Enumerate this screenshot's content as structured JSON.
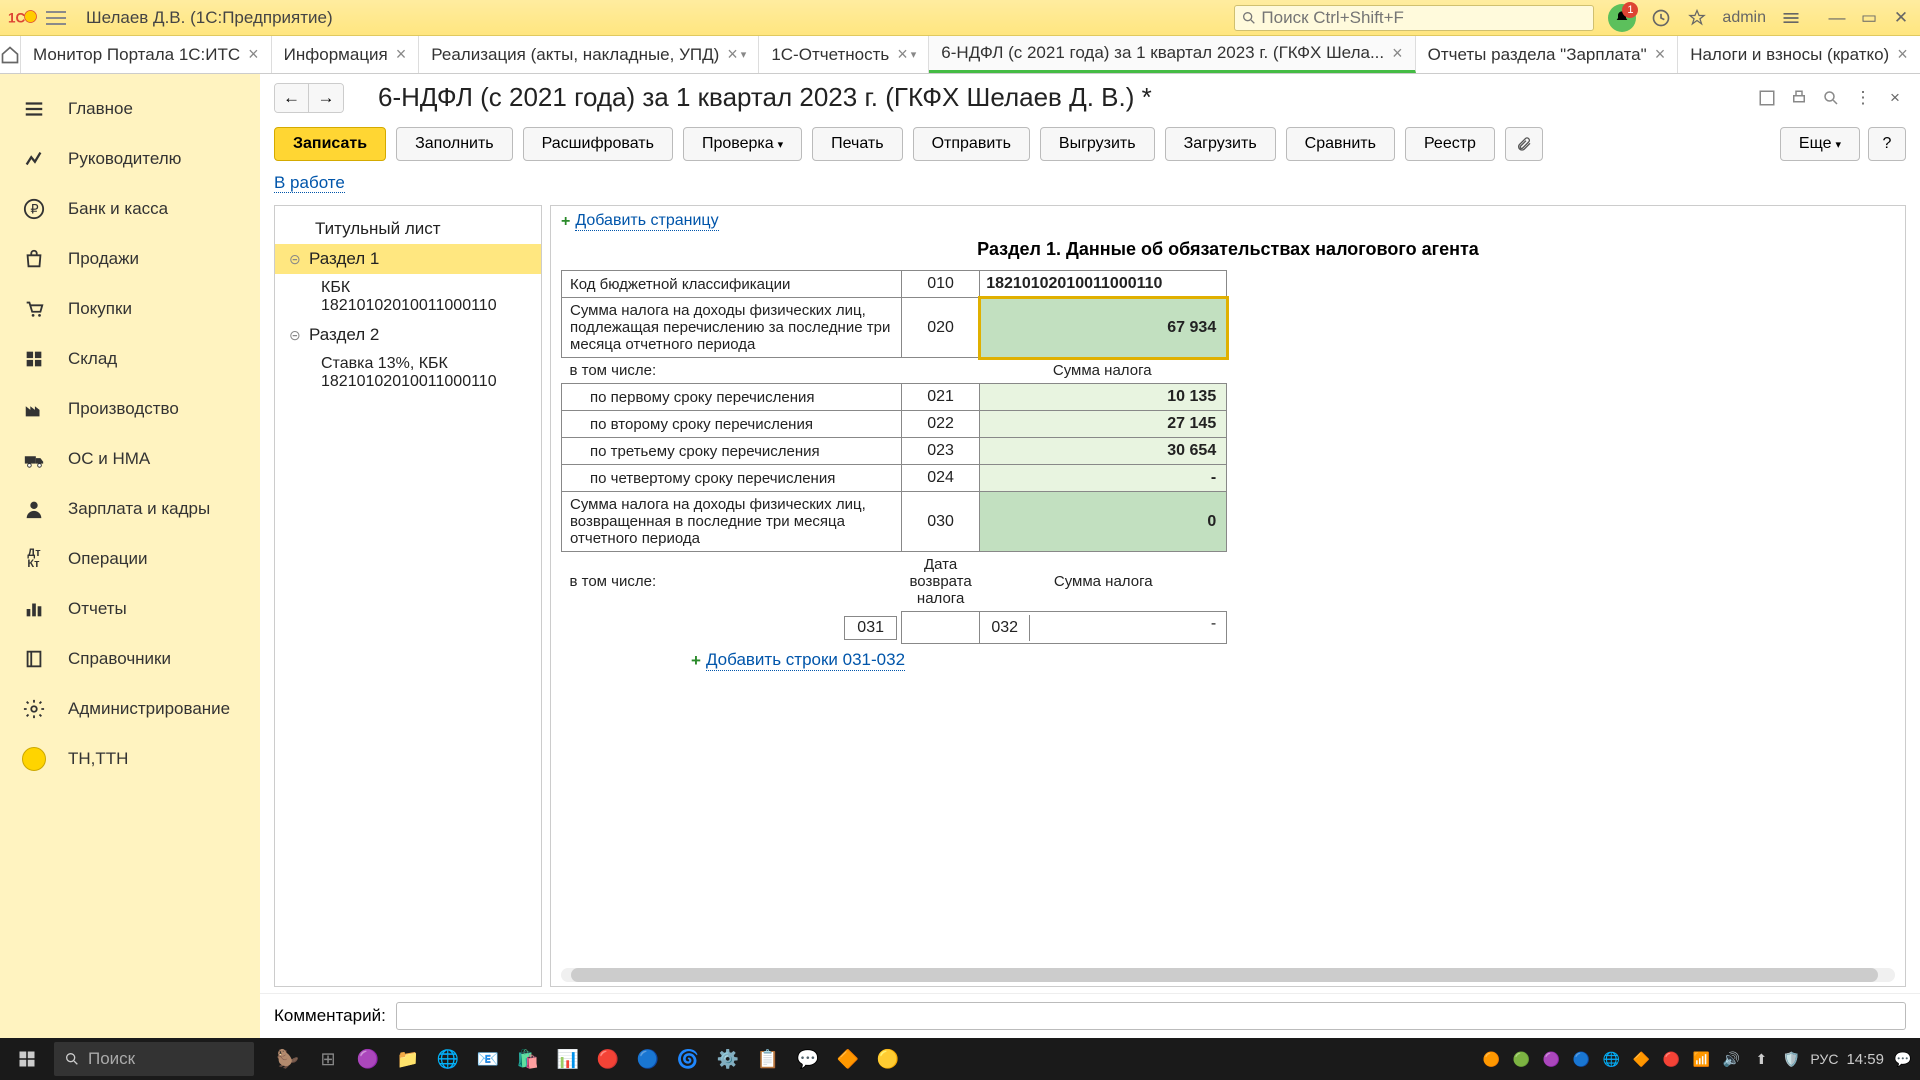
{
  "titlebar": {
    "user": "Шелаев Д.В.  (1С:Предприятие)",
    "search_placeholder": "Поиск Ctrl+Shift+F",
    "bell_count": "1",
    "admin_label": "admin"
  },
  "tabs": [
    {
      "label": "Монитор Портала 1С:ИТС"
    },
    {
      "label": "Информация"
    },
    {
      "label": "Реализация (акты, накладные, УПД)",
      "dropdown": true
    },
    {
      "label": "1С-Отчетность",
      "dropdown": true
    },
    {
      "label": "6-НДФЛ (с 2021 года) за 1 квартал 2023 г. (ГКФХ Шела...",
      "active": true
    },
    {
      "label": "Отчеты раздела \"Зарплата\""
    },
    {
      "label": "Налоги и взносы (кратко)"
    }
  ],
  "sidebar": [
    {
      "label": "Главное",
      "icon": "menu"
    },
    {
      "label": "Руководителю",
      "icon": "chart"
    },
    {
      "label": "Банк и касса",
      "icon": "ruble"
    },
    {
      "label": "Продажи",
      "icon": "bag"
    },
    {
      "label": "Покупки",
      "icon": "cart"
    },
    {
      "label": "Склад",
      "icon": "grid"
    },
    {
      "label": "Производство",
      "icon": "factory"
    },
    {
      "label": "ОС и НМА",
      "icon": "truck"
    },
    {
      "label": "Зарплата и кадры",
      "icon": "person"
    },
    {
      "label": "Операции",
      "icon": "dtkt"
    },
    {
      "label": "Отчеты",
      "icon": "bars"
    },
    {
      "label": "Справочники",
      "icon": "book"
    },
    {
      "label": "Администрирование",
      "icon": "gear"
    },
    {
      "label": "ТН,ТТН",
      "icon": "circle"
    }
  ],
  "doc": {
    "title": "6-НДФЛ (с 2021 года) за 1 квартал 2023 г. (ГКФХ Шелаев Д. В.) *",
    "buttons": {
      "save": "Записать",
      "fill": "Заполнить",
      "decode": "Расшифровать",
      "check": "Проверка",
      "print": "Печать",
      "send": "Отправить",
      "unload": "Выгрузить",
      "load": "Загрузить",
      "compare": "Сравнить",
      "registry": "Реестр",
      "more": "Еще"
    },
    "status": "В работе"
  },
  "tree": {
    "title_sheet": "Титульный лист",
    "section1": "Раздел 1",
    "kbk1": "КБК 18210102010011000110",
    "section2": "Раздел 2",
    "rate13": "Ставка 13%, КБК 18210102010011000110"
  },
  "form": {
    "add_page": "Добавить страницу",
    "section_title": "Раздел 1. Данные об обязательствах налогового агента",
    "row_kbk": "Код бюджетной классификации",
    "code_010": "010",
    "val_010": "18210102010011000110",
    "row_020": "Сумма налога на доходы физических лиц, подлежащая перечислению за последние три месяца отчетного периода",
    "code_020": "020",
    "val_020": "67 934",
    "incl": "в том числе:",
    "tax_sum_hdr": "Сумма налога",
    "r021": "по первому сроку перечисления",
    "c021": "021",
    "v021": "10 135",
    "r022": "по второму сроку перечисления",
    "c022": "022",
    "v022": "27 145",
    "r023": "по третьему сроку перечисления",
    "c023": "023",
    "v023": "30 654",
    "r024": "по четвертому сроку перечисления",
    "c024": "024",
    "v024": "-",
    "row_030": "Сумма налога на доходы физических лиц, возвращенная в последние три месяца отчетного периода",
    "code_030": "030",
    "v030": "0",
    "date_return_hdr": "Дата возврата налога",
    "c031": "031",
    "c032": "032",
    "v032": "-",
    "add_rows": "Добавить строки 031-032"
  },
  "comment": {
    "label": "Комментарий:"
  },
  "taskbar": {
    "search_placeholder": "Поиск",
    "lang": "РУС",
    "time": "14:59"
  }
}
